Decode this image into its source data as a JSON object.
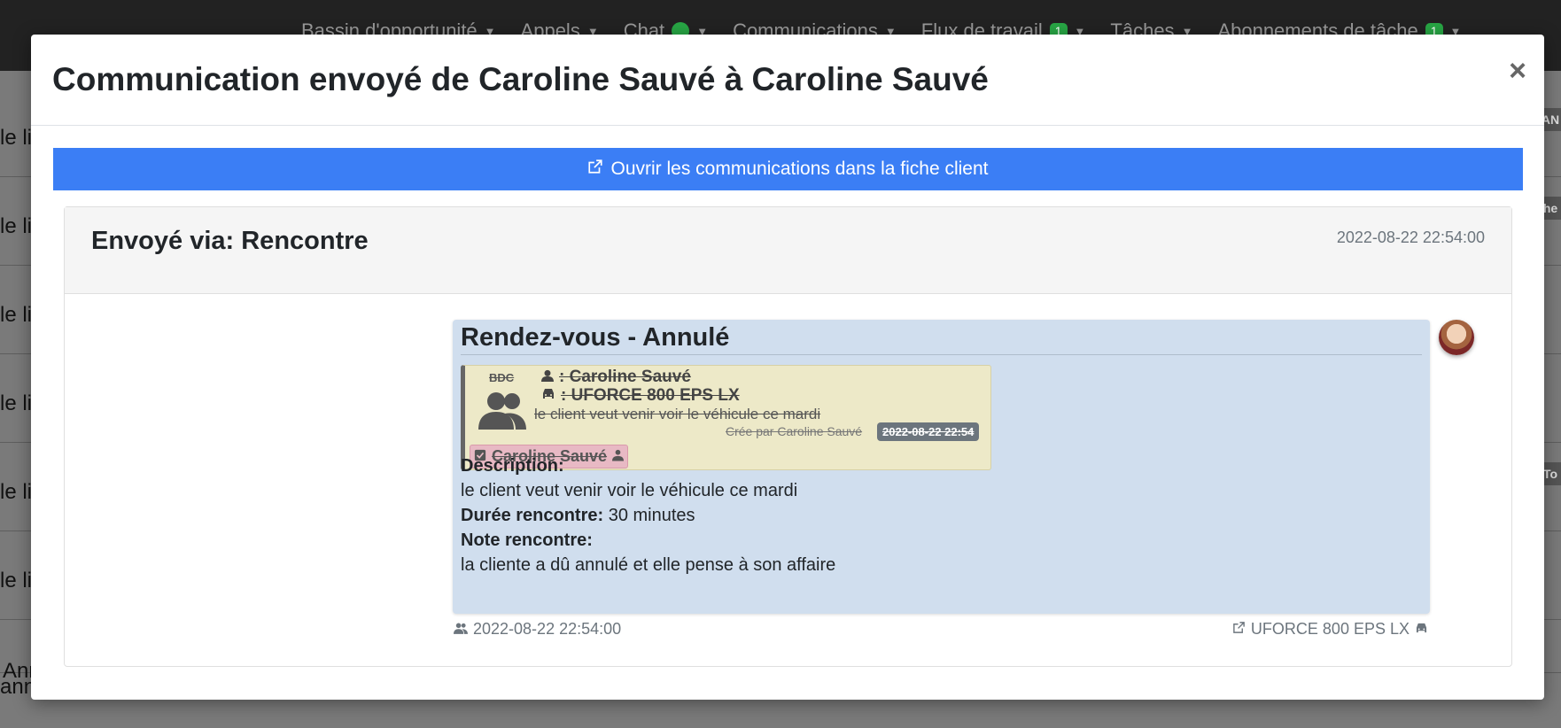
{
  "topnav": {
    "items": [
      {
        "label": "Bassin d'opportunité"
      },
      {
        "label": "Appels"
      },
      {
        "label": "Chat"
      },
      {
        "label": "Communications"
      },
      {
        "label": "Flux de travail",
        "badge": "1"
      },
      {
        "label": "Tâches"
      },
      {
        "label": "Abonnements de tâche",
        "badge": "1"
      }
    ]
  },
  "background": {
    "rows": [
      "le li",
      "le li",
      "le li",
      "le li",
      "le li",
      "le li",
      "Ann",
      "ann"
    ],
    "tags": [
      "AN",
      "he",
      "To"
    ]
  },
  "modal": {
    "title": "Communication envoyé de Caroline Sauvé à Caroline Sauvé",
    "close_label": "×",
    "open_button_label": "Ouvrir les communications dans la fiche client",
    "card": {
      "title": "Envoyé via: Rencontre",
      "date": "2022-08-22 22:54:00",
      "message": {
        "title": "Rendez-vous - Annulé",
        "appointment": {
          "bdc_label": "BDC",
          "client_line": ": Caroline Sauvé",
          "vehicle_line": ": UFORCE 800 EPS LX",
          "description": "le client veut venir voir le véhicule ce mardi",
          "creator": "Crée par Caroline Sauvé",
          "date_badge": "2022-08-22 22:54",
          "assigned_user": "Caroline Sauvé"
        },
        "description_label": "Description:",
        "description_value": "le client veut venir voir le véhicule ce mardi",
        "duration_label": "Durée rencontre:",
        "duration_value": "30 minutes",
        "note_label": "Note rencontre:",
        "note_value": "la cliente a dû annulé et elle pense à son affaire"
      },
      "footer": {
        "date": "2022-08-22 22:54:00",
        "vehicle_link": "UFORCE 800 EPS LX"
      }
    }
  },
  "colors": {
    "primary": "#3b7ef5",
    "bubble": "#d0deee",
    "appointment_box": "#ede9c8",
    "user_tag": "#e8b9c4",
    "badge_green": "#28a745"
  }
}
